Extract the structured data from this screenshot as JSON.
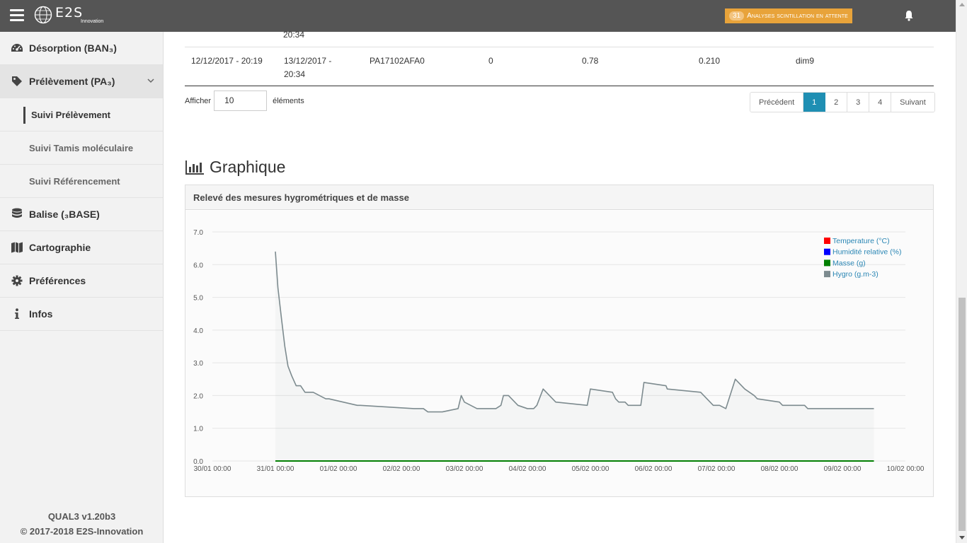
{
  "topbar": {
    "logo_text": "E2S",
    "logo_sub": "Innovation",
    "alert_count": "31",
    "alert_label": "Analyses scintillation en attente"
  },
  "sidebar": {
    "items": [
      {
        "label": "Désorption (BAN₃)",
        "icon": "dashboard-icon"
      },
      {
        "label": "Prélèvement (PA₃)",
        "icon": "tag-icon"
      },
      {
        "label": "Balise (₃BASE)",
        "icon": "database-icon"
      },
      {
        "label": "Cartographie",
        "icon": "map-icon"
      },
      {
        "label": "Préférences",
        "icon": "gear-icon"
      },
      {
        "label": "Infos",
        "icon": "info-icon"
      }
    ],
    "subitems": [
      {
        "label": "Suivi Prélèvement"
      },
      {
        "label": "Suivi Tamis moléculaire"
      },
      {
        "label": "Suivi Référencement"
      }
    ],
    "version": "QUAL3 v1.20b3",
    "copyright": "© 2017-2018 E2S-Innovation"
  },
  "table": {
    "partial_row": {
      "col2_line2": "20:34"
    },
    "row": {
      "c1": "12/12/2017 - 20:19",
      "c2a": "13/12/2017 -",
      "c2b": "20:34",
      "c3": "PA17102AFA0",
      "c4": "0",
      "c5": "0.78",
      "c6": "0.210",
      "c7": "dim9"
    }
  },
  "entries": {
    "prefix": "Afficher",
    "value": "10",
    "suffix": "éléments"
  },
  "pagination": {
    "prev": "Précédent",
    "pages": [
      "1",
      "2",
      "3",
      "4"
    ],
    "next": "Suivant",
    "current": "1"
  },
  "section": {
    "title": "Graphique",
    "panel_title": "Relevé des mesures hygrométriques et de masse"
  },
  "chart_data": {
    "type": "line",
    "ylim": [
      0,
      7
    ],
    "yticks": [
      "0.0",
      "1.0",
      "2.0",
      "3.0",
      "4.0",
      "5.0",
      "6.0",
      "7.0"
    ],
    "xticks": [
      "30/01 00:00",
      "31/01 00:00",
      "01/02 00:00",
      "02/02 00:00",
      "03/02 00:00",
      "04/02 00:00",
      "05/02 00:00",
      "06/02 00:00",
      "07/02 00:00",
      "08/02 00:00",
      "09/02 00:00",
      "10/02 00:00"
    ],
    "xlim_days": [
      0,
      11
    ],
    "legend_position": "top-right",
    "series": [
      {
        "name": "Temperature (°C)",
        "color": "#ff0000",
        "x": [],
        "y": []
      },
      {
        "name": "Humidité relative (%)",
        "color": "#0000ff",
        "x": [],
        "y": []
      },
      {
        "name": "Masse (g)",
        "color": "#008000",
        "x": [
          1.0,
          10.5
        ],
        "y": [
          0.0,
          0.0
        ]
      },
      {
        "name": "Hygro (g.m-3)",
        "color": "#7d8b8f",
        "x": [
          1.0,
          1.04,
          1.1,
          1.15,
          1.2,
          1.26,
          1.33,
          1.4,
          1.47,
          1.55,
          1.6,
          1.8,
          1.85,
          2.3,
          2.35,
          3.2,
          3.25,
          3.28,
          3.35,
          3.42,
          3.58,
          3.65,
          3.9,
          3.95,
          4.0,
          4.1,
          4.2,
          4.25,
          4.5,
          4.58,
          4.62,
          4.7,
          4.8,
          4.85,
          5.0,
          5.1,
          5.15,
          5.25,
          5.35,
          5.45,
          5.95,
          6.0,
          6.35,
          6.4,
          6.45,
          6.5,
          6.55,
          6.6,
          6.7,
          6.8,
          6.85,
          7.2,
          7.22,
          7.75,
          7.8,
          7.85,
          7.9,
          7.95,
          8.0,
          8.05,
          8.15,
          8.3,
          8.4,
          8.45,
          8.6,
          8.65,
          9.0,
          9.05,
          9.4,
          9.45,
          10.5
        ],
        "y": [
          6.4,
          5.3,
          4.3,
          3.5,
          2.9,
          2.6,
          2.3,
          2.3,
          2.1,
          2.1,
          2.1,
          1.9,
          1.9,
          1.7,
          1.7,
          1.6,
          1.6,
          1.6,
          1.6,
          1.5,
          1.5,
          1.5,
          1.6,
          2.0,
          1.8,
          1.7,
          1.6,
          1.6,
          1.6,
          1.7,
          2.0,
          2.0,
          1.8,
          1.7,
          1.6,
          1.6,
          1.7,
          2.2,
          2.0,
          1.8,
          1.7,
          2.2,
          2.1,
          1.9,
          1.8,
          1.8,
          1.8,
          1.7,
          1.7,
          1.7,
          2.4,
          2.3,
          2.2,
          2.1,
          2.0,
          1.9,
          1.8,
          1.7,
          1.7,
          1.7,
          1.6,
          2.5,
          2.3,
          2.2,
          2.0,
          1.9,
          1.8,
          1.7,
          1.7,
          1.6,
          1.6
        ]
      }
    ]
  }
}
